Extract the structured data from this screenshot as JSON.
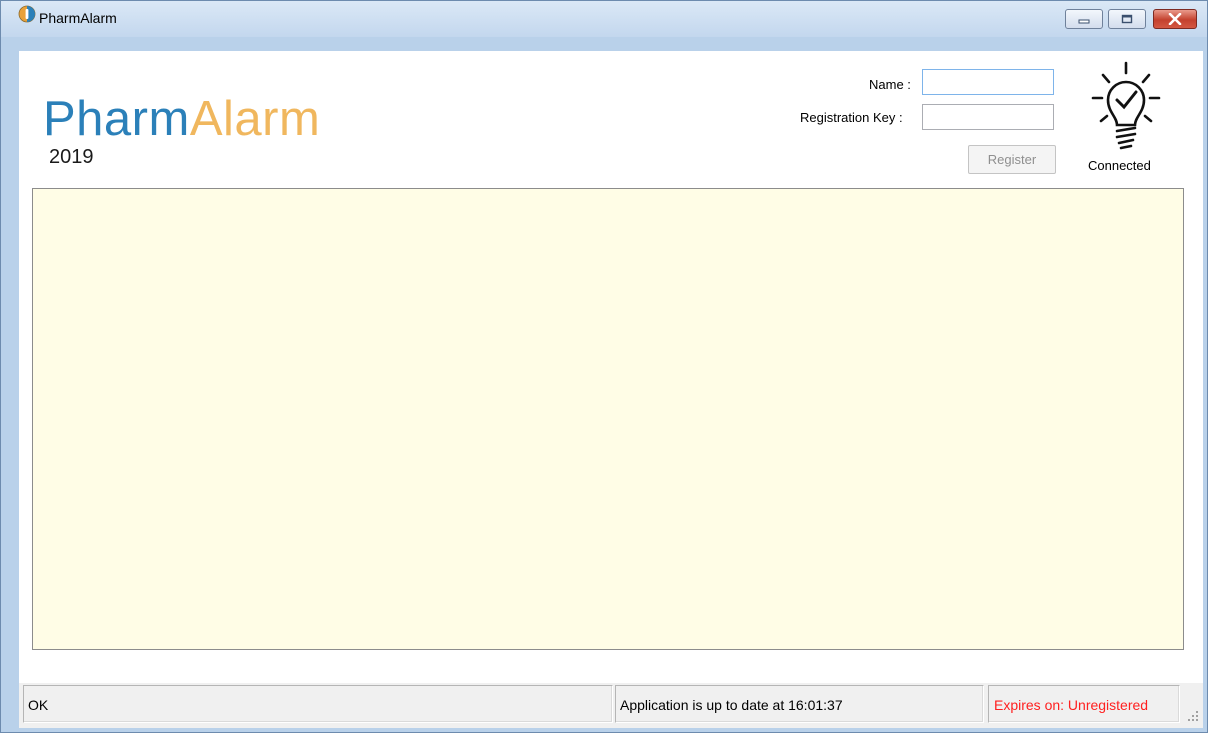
{
  "window": {
    "title": "PharmAlarm"
  },
  "brand": {
    "part1": "Pharm",
    "part2": "Alarm",
    "year": "2019"
  },
  "registration": {
    "name_label": "Name :",
    "name_value": "",
    "key_label": "Registration Key :",
    "key_value": "",
    "register_label": "Register"
  },
  "connection": {
    "icon": "lightbulb-check-icon",
    "status": "Connected"
  },
  "statusbar": {
    "status": "OK",
    "update": "Application is up to date at 16:01:37",
    "expiry": "Expires on: Unregistered"
  },
  "colors": {
    "brand_blue": "#2b80b9",
    "brand_orange": "#f0b75e",
    "panel_bg": "#fffde6",
    "expiry_red": "#ff1f1f"
  }
}
